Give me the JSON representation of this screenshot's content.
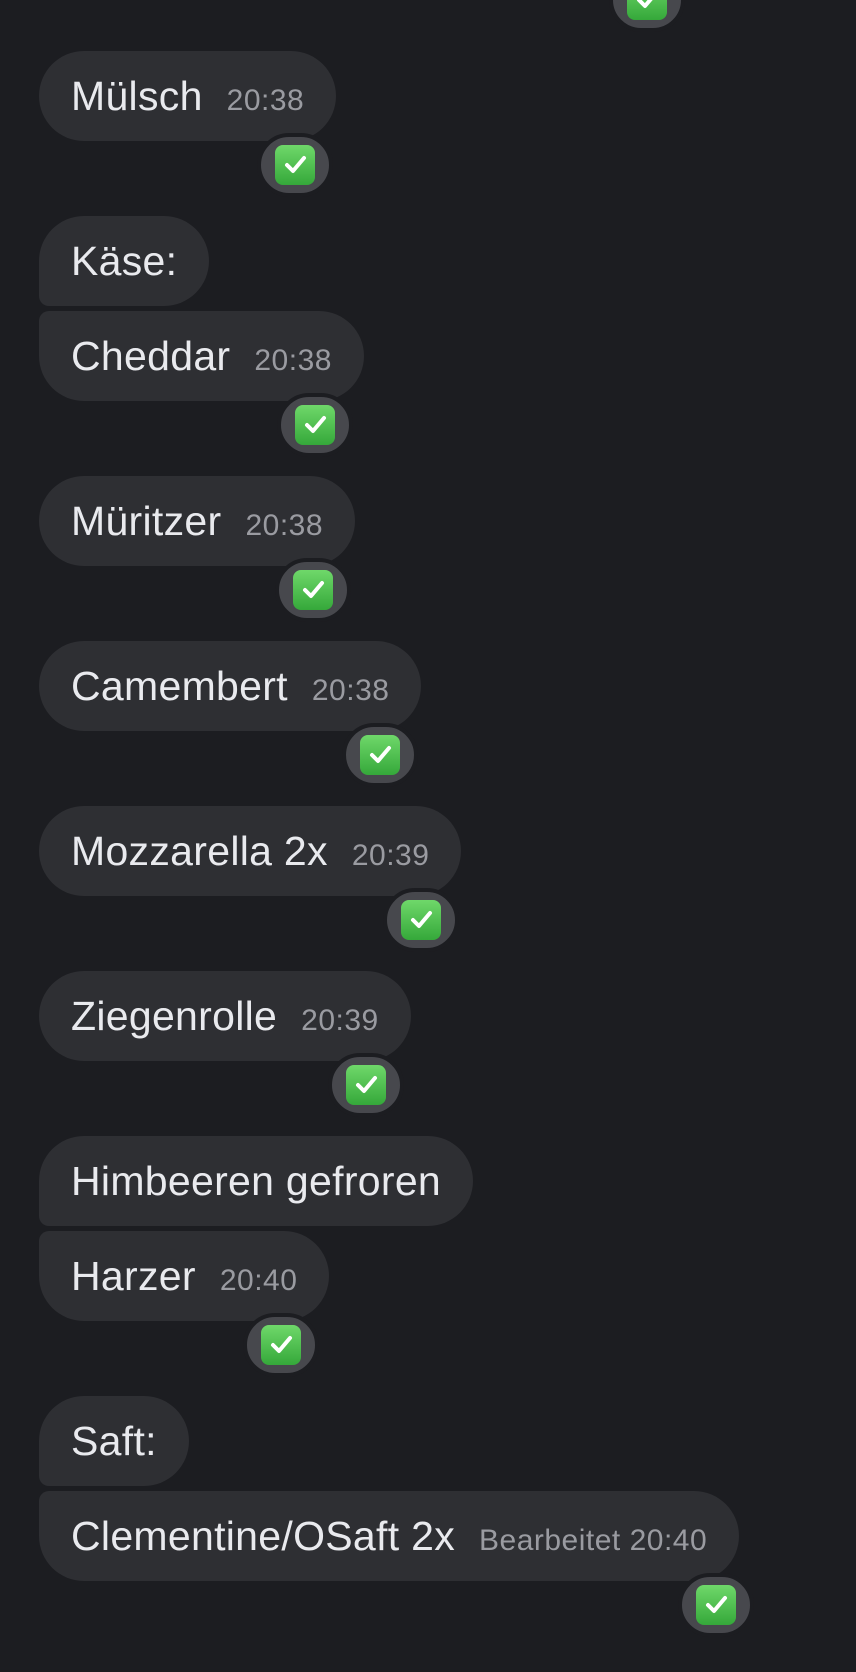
{
  "colors": {
    "background": "#1c1d21",
    "bubble": "#2e2f33",
    "text": "#e9eaee",
    "time": "#9a9ba1",
    "reaction_bg": "#47484d",
    "check_green": "#4cbf4a"
  },
  "reaction_icon": "white-heavy-check-mark-icon",
  "messages": [
    {
      "text": "Mülsch",
      "time": "20:38"
    },
    {
      "text": "Käse:"
    },
    {
      "text": "Cheddar",
      "time": "20:38"
    },
    {
      "text": "Müritzer",
      "time": "20:38"
    },
    {
      "text": "Camembert",
      "time": "20:38"
    },
    {
      "text": "Mozzarella 2x",
      "time": "20:39"
    },
    {
      "text": "Ziegenrolle",
      "time": "20:39"
    },
    {
      "text": "Himbeeren gefroren"
    },
    {
      "text": "Harzer",
      "time": "20:40"
    },
    {
      "text": "Saft:"
    },
    {
      "text": "Clementine/OSaft 2x",
      "time": "Bearbeitet 20:40"
    }
  ]
}
